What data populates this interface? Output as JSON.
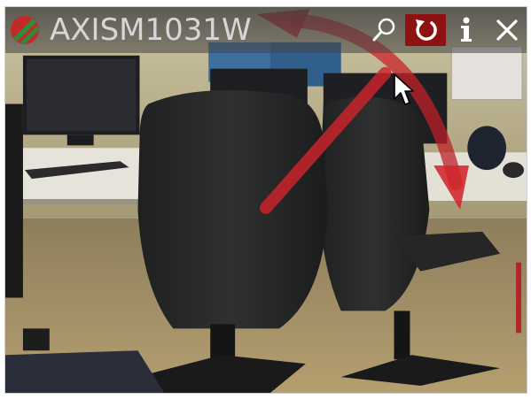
{
  "camera": {
    "name": "AXISM1031W"
  },
  "icons": {
    "logo": "axis-logo-icon",
    "search": "search-icon",
    "rotate": "rotate-icon",
    "info": "info-icon",
    "close": "close-icon",
    "cursor": "mouse-pointer-icon"
  },
  "colors": {
    "title_text": "#d6d6d6",
    "rotate_button": "#8f1212",
    "arrow_overlay": "#c8202a",
    "logo_red": "#c22a2a",
    "logo_green": "#2e8b3a"
  }
}
